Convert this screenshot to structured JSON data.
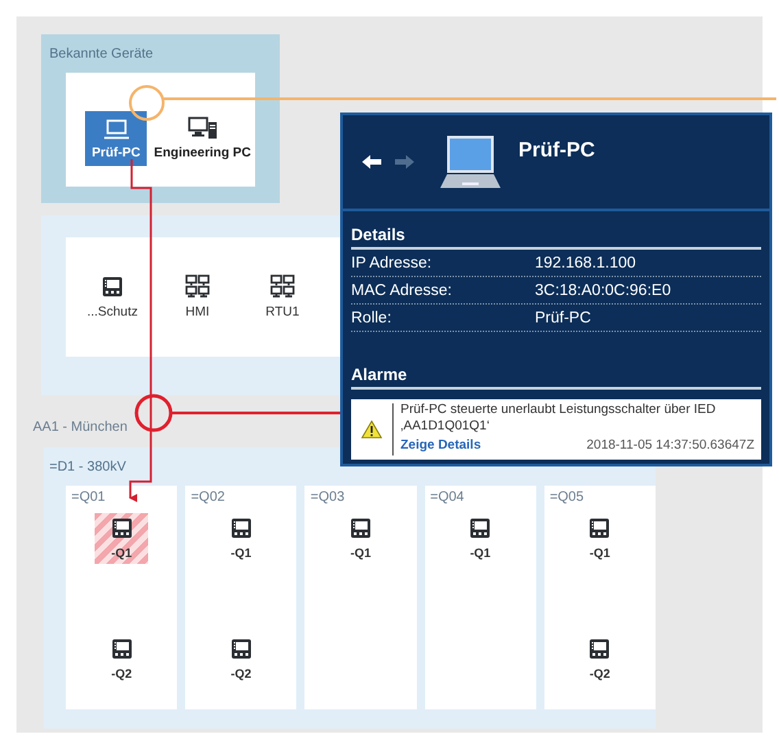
{
  "known_devices": {
    "title": "Bekannte Geräte",
    "items": [
      {
        "label": "Prüf-PC",
        "kind": "laptop",
        "selected": true
      },
      {
        "label": "Engineering PC",
        "kind": "workstation",
        "selected": false
      }
    ]
  },
  "station_devices": [
    {
      "label": "...Schutz",
      "kind": "ied"
    },
    {
      "label": "HMI",
      "kind": "network"
    },
    {
      "label": "RTU1",
      "kind": "network"
    }
  ],
  "area": {
    "title": "AA1 - München"
  },
  "voltage_level": {
    "title": "=D1 - 380kV",
    "bays": [
      {
        "name": "=Q01",
        "devices": [
          {
            "label": "-Q1",
            "alarm": true
          },
          {
            "label": "-Q2",
            "alarm": false
          }
        ]
      },
      {
        "name": "=Q02",
        "devices": [
          {
            "label": "-Q1",
            "alarm": false
          },
          {
            "label": "-Q2",
            "alarm": false
          }
        ]
      },
      {
        "name": "=Q03",
        "devices": [
          {
            "label": "-Q1",
            "alarm": false
          }
        ]
      },
      {
        "name": "=Q04",
        "devices": [
          {
            "label": "-Q1",
            "alarm": false
          }
        ]
      },
      {
        "name": "=Q05",
        "devices": [
          {
            "label": "-Q1",
            "alarm": false
          },
          {
            "label": "-Q2",
            "alarm": false
          }
        ]
      }
    ]
  },
  "detail_panel": {
    "back_enabled": true,
    "forward_enabled": false,
    "title": "Prüf-PC",
    "details_heading": "Details",
    "details": [
      {
        "label": "IP Adresse:",
        "value": "192.168.1.100"
      },
      {
        "label": "MAC Adresse:",
        "value": "3C:18:A0:0C:96:E0"
      },
      {
        "label": "Rolle:",
        "value": "Prüf-PC"
      }
    ],
    "alarms_heading": "Alarme",
    "alarms": [
      {
        "message": "Prüf-PC steuerte unerlaubt Leistungsschalter über IED ‚AA1D1Q01Q1‘",
        "link": "Zeige Details",
        "time": "2018-11-05 14:37:50.63647Z"
      }
    ]
  }
}
